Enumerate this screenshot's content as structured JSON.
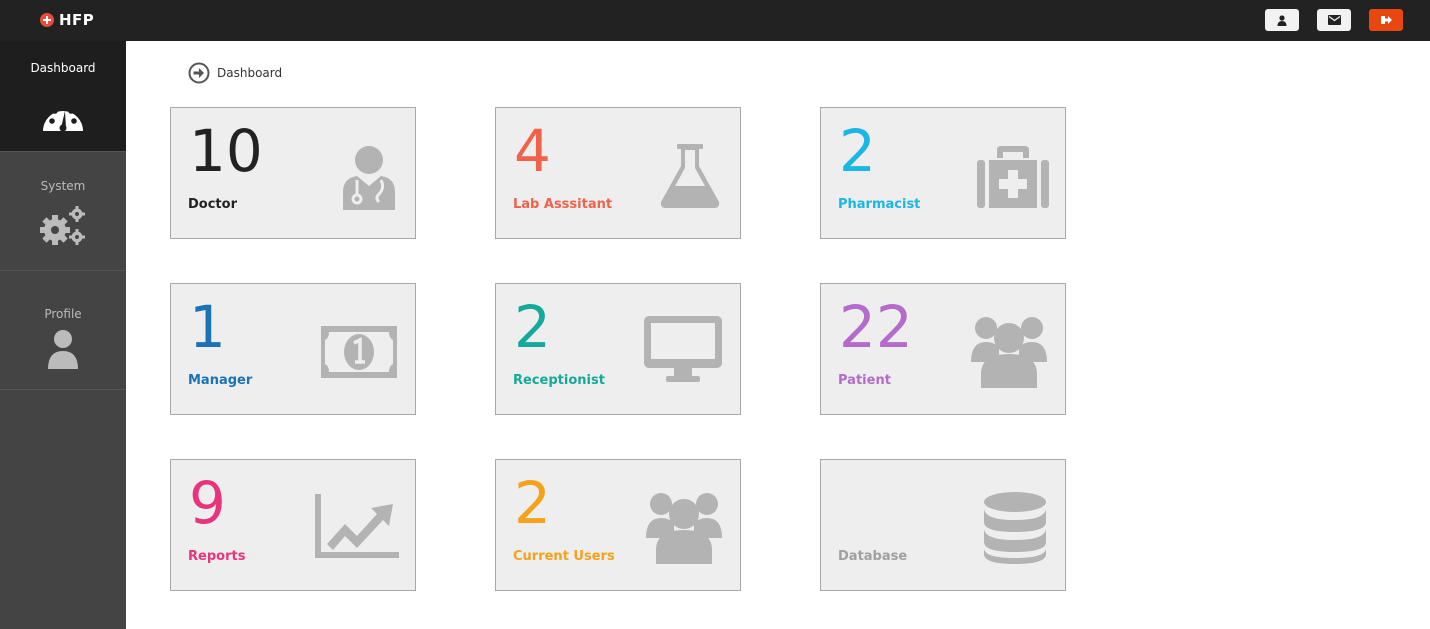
{
  "brand": {
    "name": "HFP"
  },
  "sidebar": {
    "items": [
      {
        "label": "Dashboard",
        "icon": "dashboard-gauge-icon",
        "active": true
      },
      {
        "label": "System",
        "icon": "gears-icon"
      },
      {
        "label": "Profile",
        "icon": "user-icon"
      }
    ]
  },
  "breadcrumb": {
    "label": "Dashboard",
    "icon": "arrow-circle-right-icon"
  },
  "cards": [
    {
      "count": "10",
      "label": "Doctor",
      "color": "#222222",
      "icon": "doctor-icon"
    },
    {
      "count": "4",
      "label": "Lab Asssitant",
      "color": "#f0624a",
      "icon": "flask-icon"
    },
    {
      "count": "2",
      "label": "Pharmacist",
      "color": "#1ab7e6",
      "icon": "medkit-icon"
    },
    {
      "count": "1",
      "label": "Manager",
      "color": "#1a73b7",
      "icon": "money-icon"
    },
    {
      "count": "2",
      "label": "Receptionist",
      "color": "#14a99a",
      "icon": "desktop-icon"
    },
    {
      "count": "22",
      "label": "Patient",
      "color": "#b46bcc",
      "icon": "users-icon"
    },
    {
      "count": "9",
      "label": "Reports",
      "color": "#e8347c",
      "icon": "line-chart-icon"
    },
    {
      "count": "2",
      "label": "Current Users",
      "color": "#f5a11a",
      "icon": "users-icon"
    },
    {
      "count": "",
      "label": "Database",
      "color": "#a0a0a0",
      "icon": "database-icon"
    }
  ],
  "colors": {
    "topbar": "#222222",
    "sidebar": "#444444",
    "logout": "#e8470f",
    "icon_gray": "#b3b3b3"
  }
}
